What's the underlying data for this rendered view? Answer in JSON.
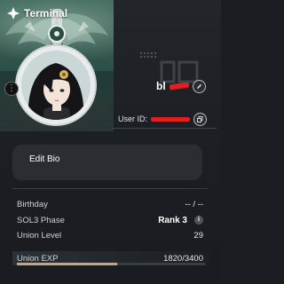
{
  "header": {
    "title": "Terminal",
    "icon": "settings-diamond-icon"
  },
  "profile": {
    "name_visible": "bl",
    "uid_label": "User ID:",
    "edit_icon": "pencil-icon",
    "copy_icon": "copy-icon",
    "back_icon": "more-dots-icon"
  },
  "bio": {
    "label": "Edit Bio"
  },
  "stats": {
    "birthday": {
      "label": "Birthday",
      "value": "-- / --"
    },
    "sol3": {
      "label": "SOL3 Phase",
      "value": "Rank 3",
      "info_icon": "info-icon"
    },
    "union_level": {
      "label": "Union Level",
      "value": "29"
    },
    "union_exp": {
      "label": "Union EXP",
      "value": "1820/3400",
      "current": 1820,
      "max": 3400
    }
  },
  "colors": {
    "background": "#1b1e22",
    "accent_exp": "#bba98f",
    "redaction": "#e21e1e"
  }
}
